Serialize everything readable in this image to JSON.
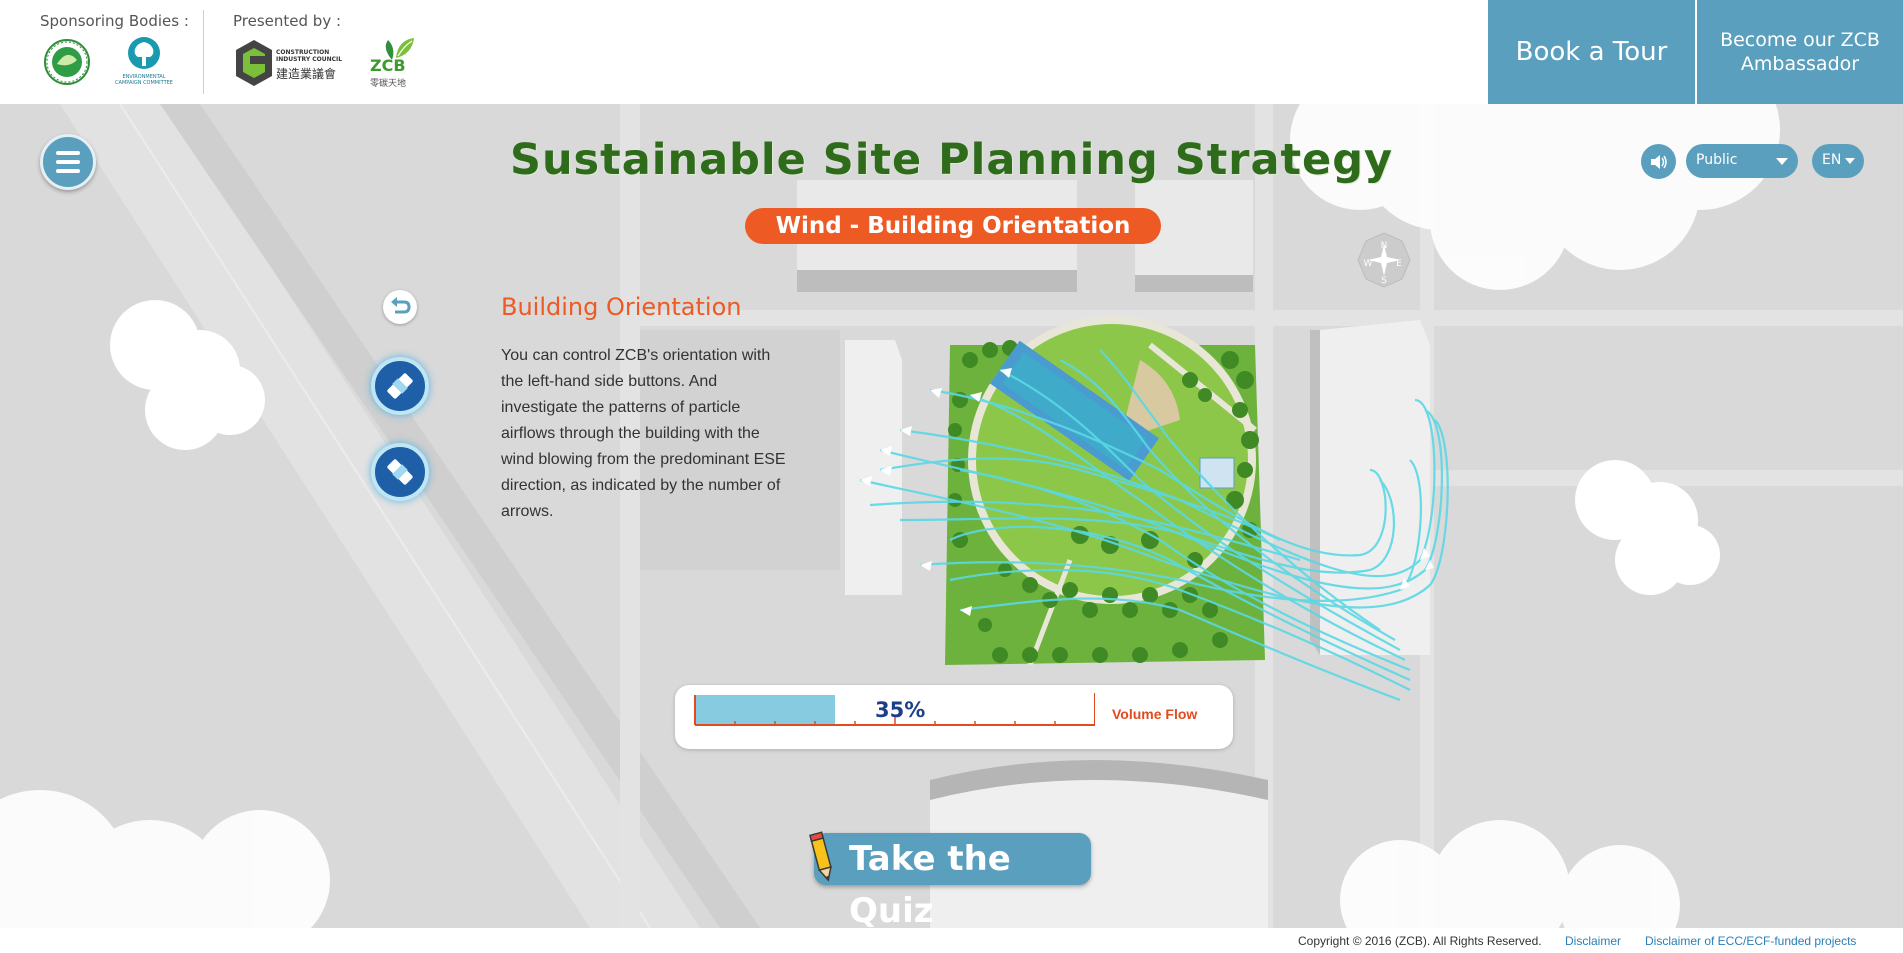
{
  "header": {
    "sponsoring_label": "Sponsoring Bodies :",
    "presented_label": "Presented by :",
    "logos": {
      "eca": "environmental-conservation-fund-logo",
      "ecc_text": "ENVIRONMENTAL CAMPAIGN COMMITTEE",
      "cic_text": "CONSTRUCTION INDUSTRY COUNCIL",
      "cic_chinese": "建造業議會",
      "zcb_text": "ZCB",
      "zcb_chinese": "零碳天地"
    },
    "book_tour_label": "Book a Tour",
    "ambassador_label": "Become our ZCB Ambassador"
  },
  "main": {
    "title": "Sustainable Site Planning Strategy",
    "subtitle": "Wind - Building Orientation",
    "audience": "Public",
    "language": "EN",
    "info_heading": "Building Orientation",
    "info_text": "You can control ZCB's orientation with the left-hand side buttons. And investigate the patterns of particle airflows through the building with the wind blowing from the predominant ESE direction, as indicated by the number of arrows.",
    "compass": {
      "n": "N",
      "s": "S",
      "e": "E",
      "w": "W"
    },
    "volume_flow": {
      "label": "Volume Flow",
      "percent_text": "35%",
      "value": 0.35
    },
    "quiz_label": "Take the Quiz"
  },
  "footer": {
    "copyright": "Copyright © 2016 (ZCB). All Rights Reserved.",
    "disclaimer": "Disclaimer",
    "disclaimer_ecc": "Disclaimer of ECC/ECF-funded projects"
  },
  "colors": {
    "accent_blue": "#5a9fbd",
    "accent_orange": "#ee5a24",
    "title_green": "#2e6b1b",
    "wind_cyan": "#5ad8e6",
    "flow_fill": "#87cbe0",
    "button_navy": "#1f5fa8"
  }
}
